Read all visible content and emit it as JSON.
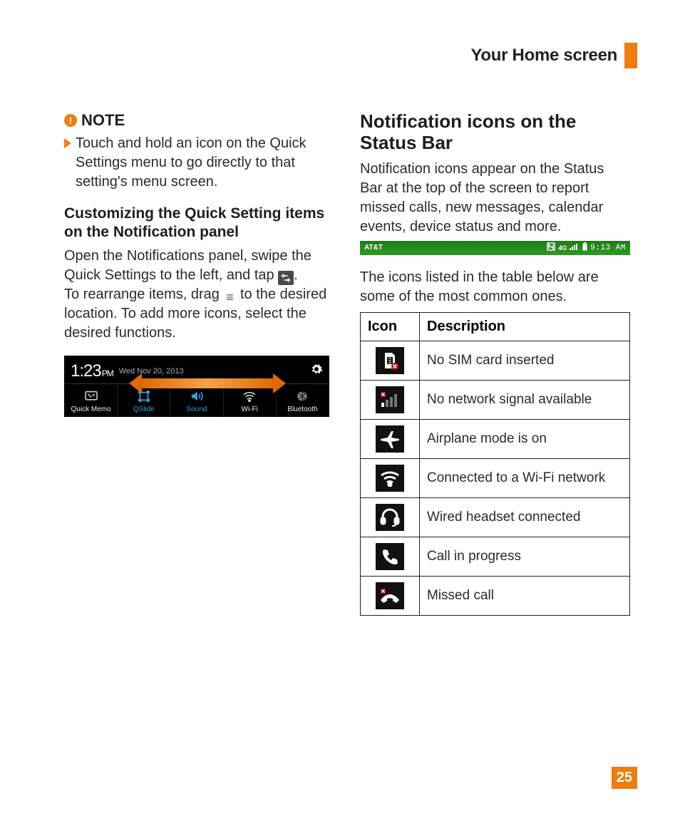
{
  "header": {
    "title": "Your Home screen"
  },
  "page_number": "25",
  "left": {
    "note_label": "NOTE",
    "note_text": "Touch and hold an icon on the Quick Settings menu to go directly to that setting's menu screen.",
    "sub_heading": "Customizing the Quick Setting items on the Notification panel",
    "para1_a": "Open the Notifications panel, swipe the Quick Settings to the left, and tap ",
    "para1_b": ".",
    "para2_a": "To rearrange items, drag ",
    "para2_b": " to the desired location. To add more icons, select the desired functions.",
    "qs": {
      "time": "1:23",
      "ampm": "PM",
      "date": "Wed Nov 20, 2013",
      "items": [
        {
          "label": "Quick Memo",
          "on": false
        },
        {
          "label": "QSlide",
          "on": true
        },
        {
          "label": "Sound",
          "on": true
        },
        {
          "label": "Wi-Fi",
          "on": false
        },
        {
          "label": "Bluetooth",
          "on": false
        }
      ]
    }
  },
  "right": {
    "heading": "Notification icons on the Status Bar",
    "intro": "Notification icons appear on the Status Bar at the top of the screen to report missed calls, new messages, calendar events, device status and more.",
    "status_bar": {
      "carrier": "AT&T",
      "time": "9:13 AM"
    },
    "after_strip": "The icons listed in the table below are some of the most common ones.",
    "table": {
      "col_icon": "Icon",
      "col_desc": "Description",
      "rows": [
        {
          "icon": "no-sim-icon",
          "desc": "No SIM card inserted"
        },
        {
          "icon": "no-signal-icon",
          "desc": "No network signal available"
        },
        {
          "icon": "airplane-icon",
          "desc": "Airplane mode is on"
        },
        {
          "icon": "wifi-icon",
          "desc": "Connected to a Wi-Fi network"
        },
        {
          "icon": "headset-icon",
          "desc": "Wired headset connected"
        },
        {
          "icon": "call-icon",
          "desc": "Call in progress"
        },
        {
          "icon": "missed-call-icon",
          "desc": "Missed call"
        }
      ]
    }
  }
}
